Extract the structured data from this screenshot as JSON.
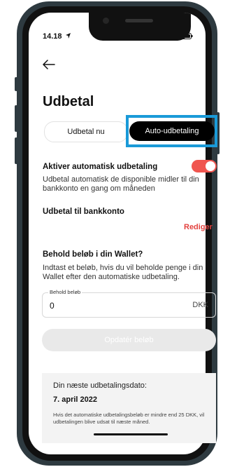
{
  "status_bar": {
    "time": "14.18"
  },
  "page": {
    "title": "Udbetal"
  },
  "tabs": [
    {
      "label": "Udbetal nu",
      "active": false
    },
    {
      "label": "Auto-udbetaling",
      "active": true
    }
  ],
  "auto_payout": {
    "label": "Aktiver automatisk udbetaling",
    "description": "Udbetal automatisk de disponible midler til din bankkonto en gang om måneden",
    "enabled": true
  },
  "bank_account": {
    "label": "Udbetal til bankkonto",
    "edit_label": "Rediger"
  },
  "keep_amount": {
    "label": "Behold beløb i din Wallet?",
    "description": "Indtast et beløb, hvis du vil beholde penge i din Wallet efter den automatiske udbetaling.",
    "field_label": "Behold beløb",
    "field_value": "0",
    "currency": "DKK"
  },
  "update_button": {
    "label": "Opdatér beløb"
  },
  "next_payout": {
    "title": "Din næste udbetalingsdato:",
    "date": "7. april 2022",
    "note": "Hvis det automatiske udbetalingsbeløb er mindre end 25 DKK, vil udbetalingen blive udsat til næste måned."
  },
  "colors": {
    "accent": "#f0554f",
    "highlight": "#1a9ad8",
    "active_tab": "#000000"
  },
  "icons": [
    "back-arrow-icon",
    "location-arrow-icon",
    "signal-icon",
    "wifi-icon",
    "battery-icon"
  ]
}
